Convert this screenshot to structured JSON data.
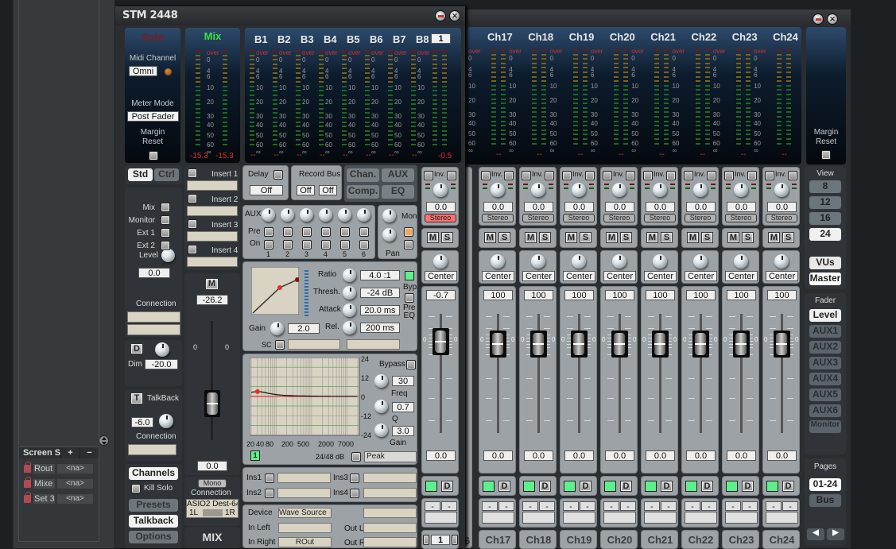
{
  "host": {
    "screens_title": "Screen Sets",
    "add_label": "+",
    "remove_label": "−",
    "sets": [
      {
        "name": "Rout",
        "value": "<na>"
      },
      {
        "name": "Mixe",
        "value": "<na>"
      },
      {
        "name": "Set 3",
        "value": "<na>"
      }
    ]
  },
  "window1": {
    "title": "STM 2448",
    "solo_label": "Solo",
    "midi_channel_label": "Midi Channel",
    "midi_channel_value": "Omni",
    "meter_mode_label": "Meter Mode",
    "meter_mode_value": "Post Fader",
    "margin_reset_label": "Margin\nReset",
    "mix_label": "Mix",
    "mix_readouts": [
      "-15.3",
      "-15.3"
    ],
    "bus_labels": [
      "B1",
      "B2",
      "B3",
      "B4",
      "B5",
      "B6",
      "B7",
      "B8"
    ],
    "bus_page": "1",
    "bus_readouts": [
      "--",
      "--",
      "--",
      "--",
      "--",
      "--",
      "--",
      "--"
    ],
    "bus_right_readout": "-0.5",
    "scale_marks": [
      "over",
      "0",
      "4",
      "6",
      "10",
      "20",
      "30",
      "40",
      "50",
      "60",
      "∞"
    ],
    "std_label": "Std",
    "ctrl_label": "Ctrl",
    "monitor_sources": [
      "Mix",
      "Monitor",
      "Ext 1",
      "Ext 2"
    ],
    "level_label": "Level",
    "level_value": "0.0",
    "connection_label": "Connection",
    "dim_button": "D",
    "dim_label": "Dim",
    "dim_value": "-20.0",
    "talkback_button": "T",
    "talkback_label": "TalkBack",
    "talkback_value": "-6.0",
    "talkback_connection_label": "Connection",
    "nav_buttons": {
      "channels": "Channels",
      "kill_solo": "Kill Solo",
      "presets": "Presets",
      "talkback": "Talkback",
      "options": "Options"
    },
    "inserts": [
      "Insert 1",
      "Insert 2",
      "Insert 3",
      "Insert 4"
    ],
    "mix_strip": {
      "mute": "M",
      "level": "-26.2",
      "fader_value": "0.0",
      "mono": "Mono",
      "connection_label": "Connection",
      "device": "ASIO2 Dest-64",
      "left": "1L",
      "right": "1R",
      "name": "MIX",
      "scale_left": "0",
      "scale_right": "0"
    },
    "channel_edit": {
      "delay_label": "Delay",
      "delay_value": "Off",
      "record_bus_label": "Record Bus",
      "record_bus_values": [
        "Off",
        "Off"
      ],
      "tabs": [
        "Chan.",
        "AUX",
        "Comp.",
        "EQ"
      ],
      "aux_label": "AUX",
      "pre_label": "Pre",
      "on_label": "On",
      "aux_numbers": [
        "1",
        "2",
        "3",
        "4",
        "5",
        "6"
      ],
      "mon_label": "Mon",
      "pan_label": "Pan",
      "comp": {
        "ratio_label": "Ratio",
        "ratio": "4.0 :1",
        "thresh_label": "Thresh.",
        "thresh": "-24 dB",
        "attack_label": "Attack",
        "attack": "20.0 ms",
        "release_label": "Rel.",
        "release": "200 ms",
        "gain_label": "Gain",
        "gain": "2.0",
        "bypass_label": "Byp.",
        "pre_eq_label": "Pre\nEQ",
        "sc_label": "SC"
      },
      "eq": {
        "bypass_label": "Bypass",
        "db_marks": [
          "24",
          "12",
          "0",
          "-12",
          "-24"
        ],
        "freq_marks": [
          "20",
          "40",
          "80",
          "200",
          "500",
          "2000",
          "7000"
        ],
        "freq": "30",
        "freq_label": "Freq",
        "q": "0.7",
        "q_label": "Q",
        "gain": "3.0",
        "gain_label": "Gain",
        "band": "1",
        "slope_label": "24/48 dB",
        "type": "Peak"
      },
      "ins_labels": [
        "Ins1",
        "Ins2",
        "Ins3",
        "Ins4"
      ],
      "device_label": "Device",
      "device_value": "Wave Source",
      "in_left_label": "In Left",
      "in_right_label": "In Right",
      "in_right_value": "ROut",
      "out_l_label": "Out L",
      "out_r_label": "Out R"
    },
    "sel_channel": {
      "inv_label": "Inv.",
      "gain": "0.0",
      "stereo": "Stereo",
      "mute": "M",
      "solo": "S",
      "pan": "Center",
      "width": "-0.7",
      "fader": "0.0",
      "d": "D",
      "route": [
        "-",
        "-"
      ],
      "number": "1",
      "scale": "0"
    }
  },
  "window2": {
    "channels": [
      {
        "name": "Ch17",
        "gain": "0.0",
        "pan": "Center",
        "width": "100",
        "fader": "0.0",
        "readout": "--"
      },
      {
        "name": "Ch18",
        "gain": "0.0",
        "pan": "Center",
        "width": "100",
        "fader": "0.0",
        "readout": "--"
      },
      {
        "name": "Ch19",
        "gain": "0.0",
        "pan": "Center",
        "width": "100",
        "fader": "0.0",
        "readout": "--"
      },
      {
        "name": "Ch20",
        "gain": "0.0",
        "pan": "Center",
        "width": "100",
        "fader": "0.0",
        "readout": "--"
      },
      {
        "name": "Ch21",
        "gain": "0.0",
        "pan": "Center",
        "width": "100",
        "fader": "0.0",
        "readout": "--"
      },
      {
        "name": "Ch22",
        "gain": "0.0",
        "pan": "Center",
        "width": "100",
        "fader": "0.0",
        "readout": "--"
      },
      {
        "name": "Ch23",
        "gain": "0.0",
        "pan": "Center",
        "width": "100",
        "fader": "0.0",
        "readout": "--"
      },
      {
        "name": "Ch24",
        "gain": "0.0",
        "pan": "Center",
        "width": "100",
        "fader": "0.0",
        "readout": "--"
      }
    ],
    "inv_label": "Inv.",
    "stereo_label": "Stereo",
    "mute": "M",
    "solo": "S",
    "d": "D",
    "route": [
      "-",
      "-"
    ],
    "margin_reset_label": "Margin\nReset",
    "view_label": "View",
    "view_options": [
      "8",
      "12",
      "16",
      "24"
    ],
    "view_selected": "24",
    "vus_label": "VUs",
    "master_label": "Master",
    "fader_label": "Fader",
    "fader_options": [
      "Level",
      "AUX1",
      "AUX2",
      "AUX3",
      "AUX4",
      "AUX5",
      "AUX6",
      "Monitor"
    ],
    "fader_selected": "Level",
    "pages_label": "Pages",
    "pages_options": [
      "01-24",
      "Bus"
    ],
    "pages_selected": "01-24",
    "prev_icon": "◀",
    "next_icon": "▶",
    "partial_channel_label": "6"
  }
}
